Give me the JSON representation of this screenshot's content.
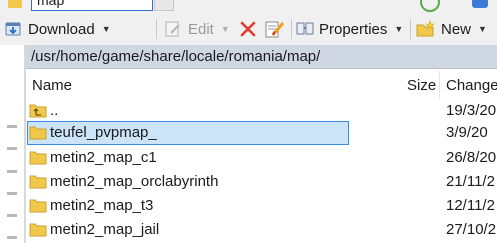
{
  "top": {
    "address_text": "map"
  },
  "toolbar": {
    "download": "Download",
    "edit": "Edit",
    "properties": "Properties",
    "new": "New"
  },
  "path": "/usr/home/game/share/locale/romania/map/",
  "columns": {
    "name": "Name",
    "size": "Size",
    "changed": "Change"
  },
  "rows": [
    {
      "name": "..",
      "date": "19/3/20",
      "type": "parent"
    },
    {
      "name": "teufel_pvpmap_",
      "date": "3/9/20",
      "type": "folder",
      "selected": true,
      "editing": true
    },
    {
      "name": "metin2_map_c1",
      "date": "26/8/20",
      "type": "folder"
    },
    {
      "name": "metin2_map_orclabyrinth",
      "date": "21/11/2",
      "type": "folder"
    },
    {
      "name": "metin2_map_t3",
      "date": "12/11/2",
      "type": "folder"
    },
    {
      "name": "metin2_map_jail",
      "date": "27/10/2",
      "type": "folder"
    }
  ],
  "colors": {
    "accent": "#3b8de0",
    "selection": "#cce4f7",
    "pathbar": "#cfd7e3",
    "folder": "#f2c84b",
    "delete": "#e23b2e"
  }
}
